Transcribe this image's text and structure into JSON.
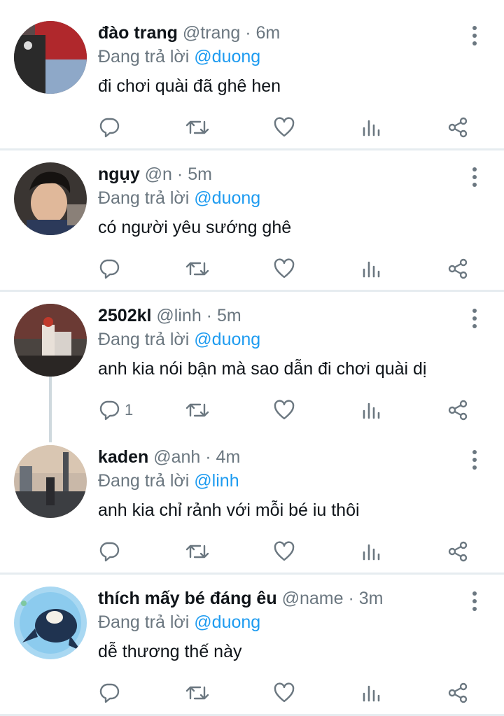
{
  "colors": {
    "accent": "#1d9bf0",
    "muted": "#6b7780",
    "text": "#0f1419",
    "divider": "#e6ecf0"
  },
  "icons": [
    "reply-icon",
    "retweet-icon",
    "like-icon",
    "views-icon",
    "share-icon",
    "more-options-icon"
  ],
  "replies": [
    {
      "name": "đào trang",
      "handle": "@trang",
      "dot": "·",
      "time": "6m",
      "replying_prefix": "Đang trả lời",
      "replying_to": "@duong",
      "text": "đi chơi quài đã ghê hen",
      "reply_count": ""
    },
    {
      "name": "ngụy",
      "handle": "@n",
      "dot": "·",
      "time": "5m",
      "replying_prefix": "Đang trả lời",
      "replying_to": "@duong",
      "text": "có người yêu sướng ghê",
      "reply_count": ""
    },
    {
      "name": "2502kl",
      "handle": "@linh",
      "dot": "·",
      "time": "5m",
      "replying_prefix": "Đang trả lời",
      "replying_to": "@duong",
      "text": "anh kia nói bận mà sao dẫn đi chơi quài dị",
      "reply_count": "1"
    },
    {
      "name": "kaden",
      "handle": "@anh",
      "dot": "·",
      "time": "4m",
      "replying_prefix": "Đang trả lời",
      "replying_to": "@linh",
      "text": "anh kia chỉ rảnh với mỗi bé iu thôi",
      "reply_count": ""
    },
    {
      "name": "thích mấy bé đáng êu",
      "handle": "@name",
      "dot": "·",
      "time": "3m",
      "replying_prefix": "Đang trả lời",
      "replying_to": "@duong",
      "text": "dễ thương thế này",
      "reply_count": ""
    }
  ]
}
